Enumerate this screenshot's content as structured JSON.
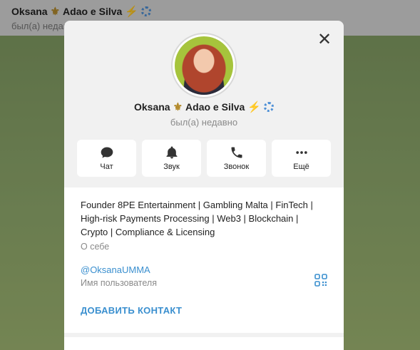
{
  "chat_header": {
    "name_first": "Oksana",
    "name_rest": "Adao e Silva",
    "status": "был(а) недавно"
  },
  "profile": {
    "name_first": "Oksana",
    "name_rest": "Adao e Silva",
    "status": "был(а) недавно",
    "emoji_fleur": "⚜",
    "emoji_bolt": "⚡"
  },
  "actions": [
    {
      "label": "Чат",
      "icon": "chat-icon"
    },
    {
      "label": "Звук",
      "icon": "bell-icon"
    },
    {
      "label": "Звонок",
      "icon": "phone-icon"
    },
    {
      "label": "Ещё",
      "icon": "more-icon"
    }
  ],
  "info": {
    "bio": "Founder 8PE Entertainment | Gambling Malta | FinTech | High-risk Payments Processing | Web3 | Blockchain | Crypto | Compliance & Licensing",
    "bio_caption": "О себе",
    "username": "@OksanaUMMA",
    "username_caption": "Имя пользователя",
    "add_contact": "ДОБАВИТЬ КОНТАКТ"
  },
  "colors": {
    "accent": "#3a8fcf",
    "muted": "#8a8a8a"
  }
}
